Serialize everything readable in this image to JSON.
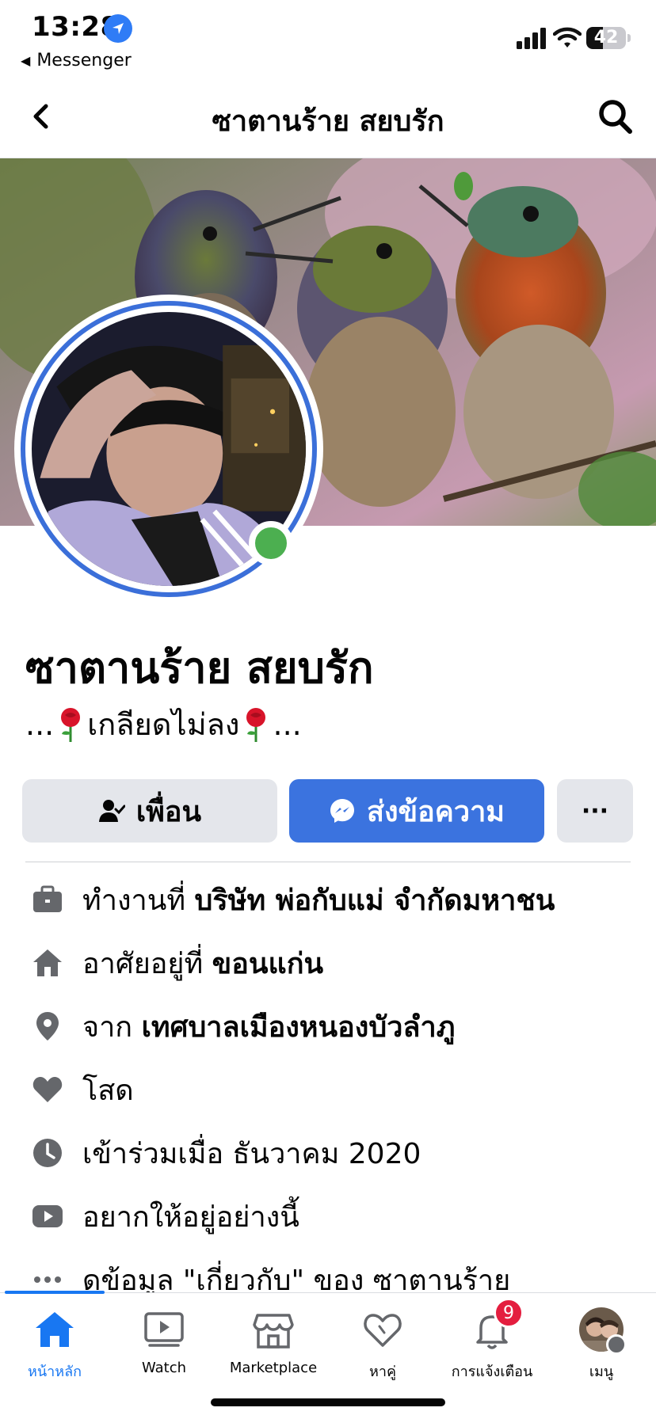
{
  "status_bar": {
    "time": "13:28",
    "back_app": "Messenger",
    "battery_level": 42,
    "battery_text": "42",
    "icons": [
      "location-arrow-icon",
      "cellular-signal-icon",
      "wifi-icon",
      "battery-icon"
    ]
  },
  "header": {
    "title": "ซาตานร้าย สยบรัก",
    "icons": [
      "chevron-left-icon",
      "search-icon"
    ]
  },
  "profile": {
    "name": "ซาตานร้าย สยบรัก",
    "bio_prefix": "...",
    "bio_middle": "เกลียดไม่ลง",
    "bio_suffix": "...",
    "online": true,
    "colors": {
      "online": "#4caf50",
      "ring": "#3b6fd9"
    }
  },
  "actions": {
    "friend_label": "เพื่อน",
    "message_label": "ส่งข้อความ",
    "more_label": "···",
    "colors": {
      "primary": "#3b73df",
      "secondary": "#e4e6eb"
    }
  },
  "info": {
    "work_prefix": "ทำงานที่ ",
    "work_value": "บริษัท พ่อกับแม่ จำกัดมหาชน",
    "lives_prefix": "อาศัยอยู่ที่ ",
    "lives_value": "ขอนแก่น",
    "from_prefix": "จาก ",
    "from_value": "เทศบาลเมืองหนองบัวลำภู",
    "relationship": "โสด",
    "joined": "เข้าร่วมเมื่อ ธันวาคม  2020",
    "video_text": "อยากให้อยู่อย่างนี้",
    "see_about": "ดูข้อมูล \"เกี่ยวกับ\" ของ ซาตานร้าย"
  },
  "tabbar": {
    "tabs": [
      {
        "label": "หน้าหลัก",
        "icon": "home-icon",
        "active": true
      },
      {
        "label": "Watch",
        "icon": "watch-video-icon",
        "active": false
      },
      {
        "label": "Marketplace",
        "icon": "marketplace-shop-icon",
        "active": false
      },
      {
        "label": "หาคู่",
        "icon": "dating-heart-icon",
        "active": false
      },
      {
        "label": "การแจ้งเตือน",
        "icon": "bell-icon",
        "active": false,
        "badge": "9"
      },
      {
        "label": "เมนู",
        "icon": "menu-avatar-icon",
        "active": false
      }
    ],
    "accent": "#1877f2"
  }
}
